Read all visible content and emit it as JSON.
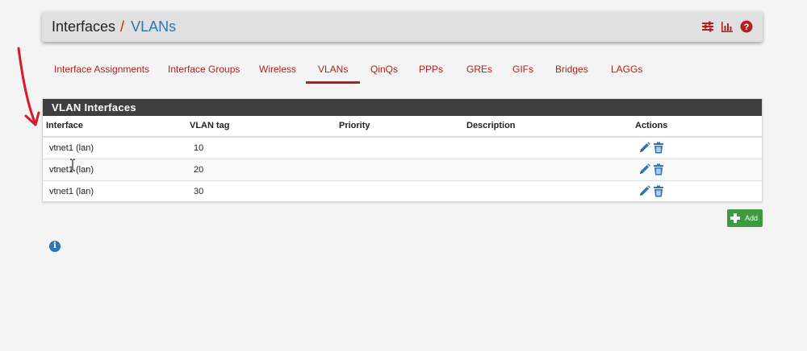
{
  "header": {
    "breadcrumb_parent": "Interfaces",
    "separator": "/",
    "breadcrumb_current": "VLANs",
    "icons": [
      "sliders-icon",
      "bar-chart-icon",
      "help-icon"
    ]
  },
  "tabs": [
    {
      "label": "Interface Assignments",
      "active": false
    },
    {
      "label": "Interface Groups",
      "active": false
    },
    {
      "label": "Wireless",
      "active": false
    },
    {
      "label": "VLANs",
      "active": true
    },
    {
      "label": "QinQs",
      "active": false
    },
    {
      "label": "PPPs",
      "active": false
    },
    {
      "label": "GREs",
      "active": false
    },
    {
      "label": "GIFs",
      "active": false
    },
    {
      "label": "Bridges",
      "active": false
    },
    {
      "label": "LAGGs",
      "active": false
    }
  ],
  "panel": {
    "title": "VLAN Interfaces",
    "columns": [
      "Interface",
      "VLAN tag",
      "Priority",
      "Description",
      "Actions"
    ],
    "rows": [
      {
        "interface": "vtnet1 (lan)",
        "vlan_tag": "10",
        "priority": "",
        "description": ""
      },
      {
        "interface": "vtnet1 (lan)",
        "vlan_tag": "20",
        "priority": "",
        "description": ""
      },
      {
        "interface": "vtnet1 (lan)",
        "vlan_tag": "30",
        "priority": "",
        "description": ""
      }
    ]
  },
  "add_button": {
    "label": "Add"
  },
  "colors": {
    "brand_red": "#b32020",
    "link_blue": "#2e74b5",
    "panel_heading": "#3f3f3f",
    "add_green": "#3f9a3f",
    "annotation_red": "#d8192a"
  }
}
